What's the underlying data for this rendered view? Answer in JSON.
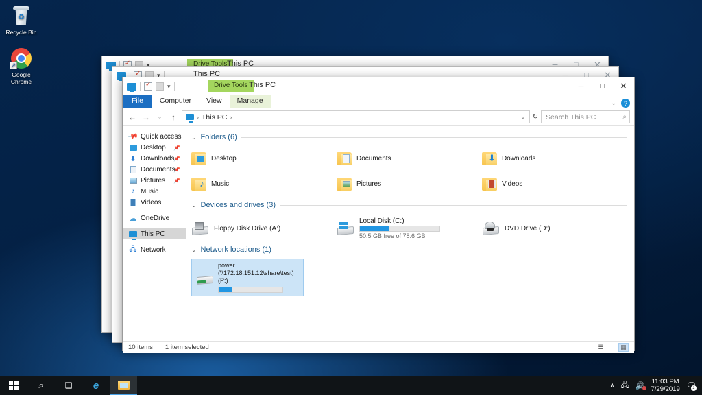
{
  "desktop": {
    "icons": [
      {
        "name": "Recycle Bin",
        "icon": "recycle-bin-icon"
      },
      {
        "name": "Google\nChrome",
        "label_line1": "Google",
        "label_line2": "Chrome",
        "icon": "google-chrome-icon"
      }
    ],
    "background_color": "#05254c"
  },
  "window": {
    "title": "This PC",
    "context_tab": "Drive Tools",
    "quick_access_toolbar": [
      "explorer-icon",
      "properties-icon",
      "new-folder-icon",
      "customize-caret"
    ],
    "controls": {
      "minimize": "─",
      "maximize": "□",
      "close": "✕",
      "help": "?"
    },
    "ribbon_tabs": [
      {
        "label": "File",
        "type": "file"
      },
      {
        "label": "Computer",
        "type": "normal"
      },
      {
        "label": "View",
        "type": "normal"
      },
      {
        "label": "Manage",
        "type": "contextual"
      }
    ],
    "address": {
      "back": "←",
      "forward": "→",
      "recent": "⌄",
      "up": "↑",
      "crumb_root": "This PC",
      "crumb_sep": "›",
      "dropdown": "⌄",
      "refresh": "↻"
    },
    "search": {
      "placeholder": "Search This PC",
      "icon": "search-icon"
    },
    "sidebar": [
      {
        "label": "Quick access",
        "icon": "pin-icon",
        "pinned": false
      },
      {
        "label": "Desktop",
        "icon": "desktop-icon",
        "pinned": true
      },
      {
        "label": "Downloads",
        "icon": "downloads-icon",
        "pinned": true
      },
      {
        "label": "Documents",
        "icon": "documents-icon",
        "pinned": true
      },
      {
        "label": "Pictures",
        "icon": "pictures-icon",
        "pinned": true
      },
      {
        "label": "Music",
        "icon": "music-icon",
        "pinned": false
      },
      {
        "label": "Videos",
        "icon": "videos-icon",
        "pinned": false
      },
      {
        "label": "OneDrive",
        "icon": "onedrive-icon",
        "pinned": false
      },
      {
        "label": "This PC",
        "icon": "thispc-icon",
        "pinned": false,
        "selected": true
      },
      {
        "label": "Network",
        "icon": "network-icon",
        "pinned": false
      }
    ],
    "groups": {
      "folders": {
        "label": "Folders (6)",
        "items": [
          {
            "label": "Desktop",
            "icon": "folder-desktop-icon"
          },
          {
            "label": "Documents",
            "icon": "folder-documents-icon"
          },
          {
            "label": "Downloads",
            "icon": "folder-downloads-icon"
          },
          {
            "label": "Music",
            "icon": "folder-music-icon"
          },
          {
            "label": "Pictures",
            "icon": "folder-pictures-icon"
          },
          {
            "label": "Videos",
            "icon": "folder-videos-icon"
          }
        ]
      },
      "devices": {
        "label": "Devices and drives (3)",
        "items": [
          {
            "label": "Floppy Disk Drive (A:)",
            "icon": "floppy-drive-icon",
            "has_bar": false
          },
          {
            "label": "Local Disk (C:)",
            "icon": "local-disk-icon",
            "has_bar": true,
            "free_text": "50.5 GB free of 78.6 GB",
            "used_percent": 36
          },
          {
            "label": "DVD Drive (D:)",
            "icon": "dvd-drive-icon",
            "has_bar": false
          }
        ]
      },
      "network": {
        "label": "Network locations (1)",
        "items": [
          {
            "label_line1": "power (\\\\172.18.151.12\\share\\test)",
            "label_line2": "(P:)",
            "icon": "network-drive-icon",
            "has_bar": true,
            "used_percent": 22,
            "selected": true
          }
        ]
      }
    },
    "status": {
      "items_count": "10 items",
      "selection": "1 item selected",
      "view_details": "details-view-icon",
      "view_large": "large-icons-view-icon"
    }
  },
  "background_windows": [
    {
      "title": "This PC",
      "context_tab": "Drive Tools"
    },
    {
      "title": "This PC",
      "context_tab": ""
    }
  ],
  "taskbar": {
    "start": "start-icon",
    "search": "search-icon",
    "taskview": "task-view-icon",
    "edge": "edge-icon",
    "explorer": "file-explorer-icon",
    "tray": {
      "chevron": "∧",
      "network": "network-tray-icon",
      "volume": "volume-muted-icon",
      "time": "11:03 PM",
      "date": "7/29/2019",
      "action_center": "action-center-icon"
    }
  }
}
